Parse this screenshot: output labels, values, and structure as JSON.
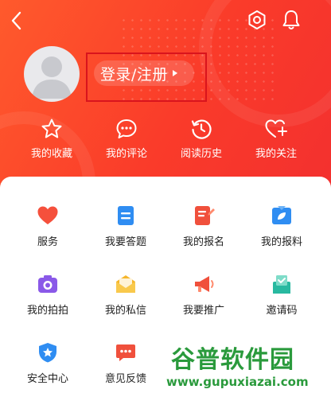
{
  "header": {
    "background_color": "#fa3b2a",
    "login_label": "登录/注册",
    "highlight_color": "#d9141d"
  },
  "topbar": {
    "back_icon": "chevron-left-icon",
    "settings_icon": "gear-icon",
    "notify_icon": "bell-icon"
  },
  "quick_actions": [
    {
      "label": "我的收藏",
      "icon": "star-icon"
    },
    {
      "label": "我的评论",
      "icon": "comment-icon"
    },
    {
      "label": "阅读历史",
      "icon": "history-icon"
    },
    {
      "label": "我的关注",
      "icon": "heart-plus-icon"
    }
  ],
  "grid": [
    {
      "label": "服务",
      "icon": "heart-icon",
      "color": "#f5503c"
    },
    {
      "label": "我要答题",
      "icon": "list-icon",
      "color": "#2f8df2"
    },
    {
      "label": "我的报名",
      "icon": "form-edit-icon",
      "color": "#f0503c"
    },
    {
      "label": "我的报料",
      "icon": "leaf-icon",
      "color": "#2f8df2"
    },
    {
      "label": "我的拍拍",
      "icon": "camera-icon",
      "color": "#8a59e8"
    },
    {
      "label": "我的私信",
      "icon": "mail-icon",
      "color": "#f6b62b"
    },
    {
      "label": "我要推广",
      "icon": "megaphone-icon",
      "color": "#f0503c"
    },
    {
      "label": "邀请码",
      "icon": "invite-icon",
      "color": "#28b9a0"
    },
    {
      "label": "安全中心",
      "icon": "shield-icon",
      "color": "#2f8df2"
    },
    {
      "label": "意见反馈",
      "icon": "feedback-icon",
      "color": "#f0503c"
    }
  ],
  "watermark": {
    "title": "谷普软件园",
    "url": "www.gupuxiazai.com"
  }
}
